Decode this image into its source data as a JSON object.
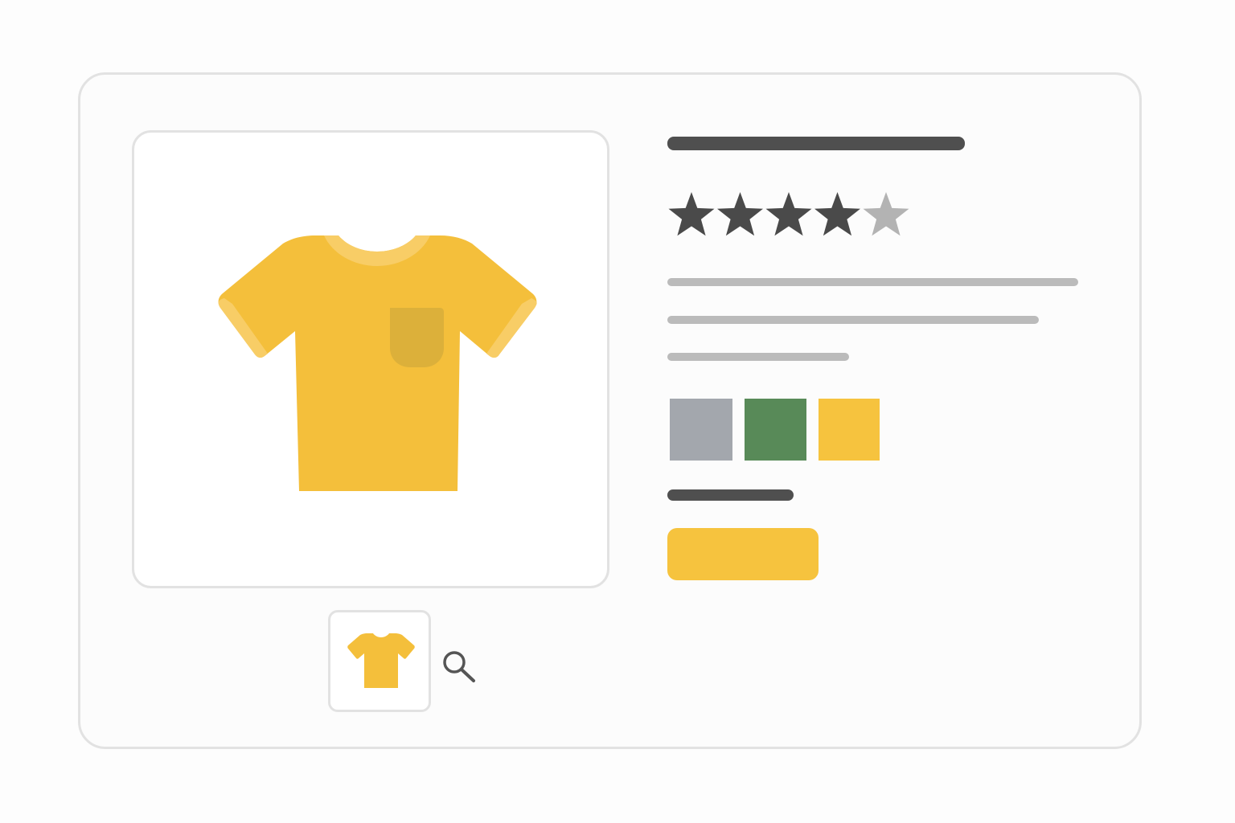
{
  "product": {
    "image_icon": "t-shirt-icon",
    "image_color": "#f4bf3b",
    "thumbnail_icon": "t-shirt-icon",
    "zoom_icon": "magnifier-icon",
    "rating": 4,
    "rating_max": 5,
    "rating_filled_color": "#4a4a4a",
    "rating_empty_color": "#b3b3b3"
  },
  "swatches": [
    {
      "name": "gray",
      "color": "#a3a7ad"
    },
    {
      "name": "green",
      "color": "#588a58"
    },
    {
      "name": "yellow",
      "color": "#f6c33e"
    }
  ],
  "cta": {
    "label": "",
    "color": "#f6c33e"
  }
}
